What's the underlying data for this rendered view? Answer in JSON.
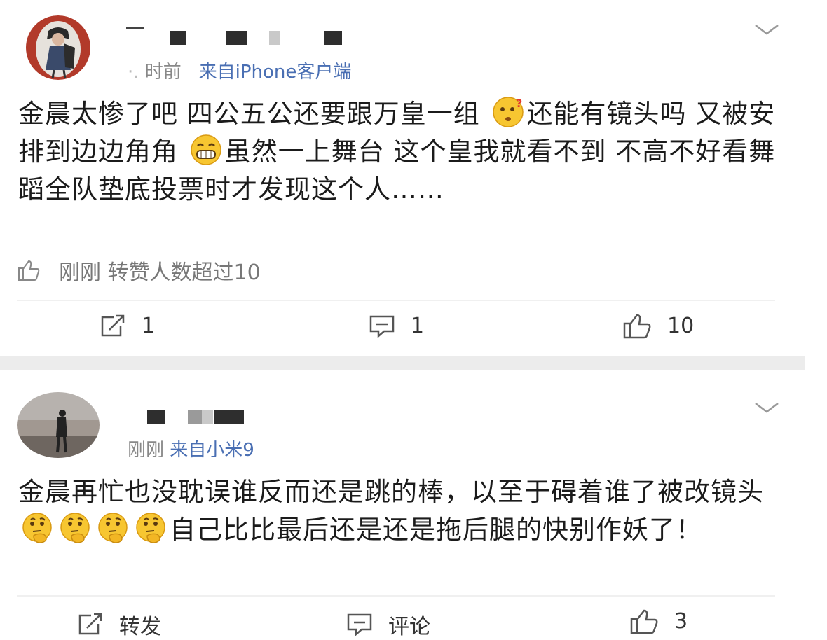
{
  "posts": [
    {
      "meta_time": "时前",
      "meta_source": "来自iPhone客户端",
      "content_parts": [
        "金晨太惨了吧 四公五公还要跟万皇一组 ",
        "还能有镜头吗 又被安排到边边角角 ",
        "虽然一上舞台 这个皇我就看不到 不高不好看舞蹈全队垫底投票时才发现这个人……"
      ],
      "emojis": [
        "confused-face",
        "grinning-face"
      ],
      "liked_text": "刚刚 转赞人数超过10",
      "repost": "1",
      "comment": "1",
      "like": "10"
    },
    {
      "meta_time": "刚刚",
      "meta_source": "来自小米9",
      "content_parts": [
        "金晨再忙也没耽误谁反而还是跳的棒，以至于碍着谁了被改镜头 ",
        "自己比比最后还是还是拖后腿的快别作妖了！"
      ],
      "emojis": [
        "thinking-face",
        "thinking-face",
        "thinking-face",
        "thinking-face"
      ],
      "repost": "转发",
      "comment": "评论",
      "like": "3"
    }
  ],
  "colors": {
    "meta_gray": "#888888",
    "source_blue": "#4a6fb3",
    "separator": "#ececec"
  }
}
